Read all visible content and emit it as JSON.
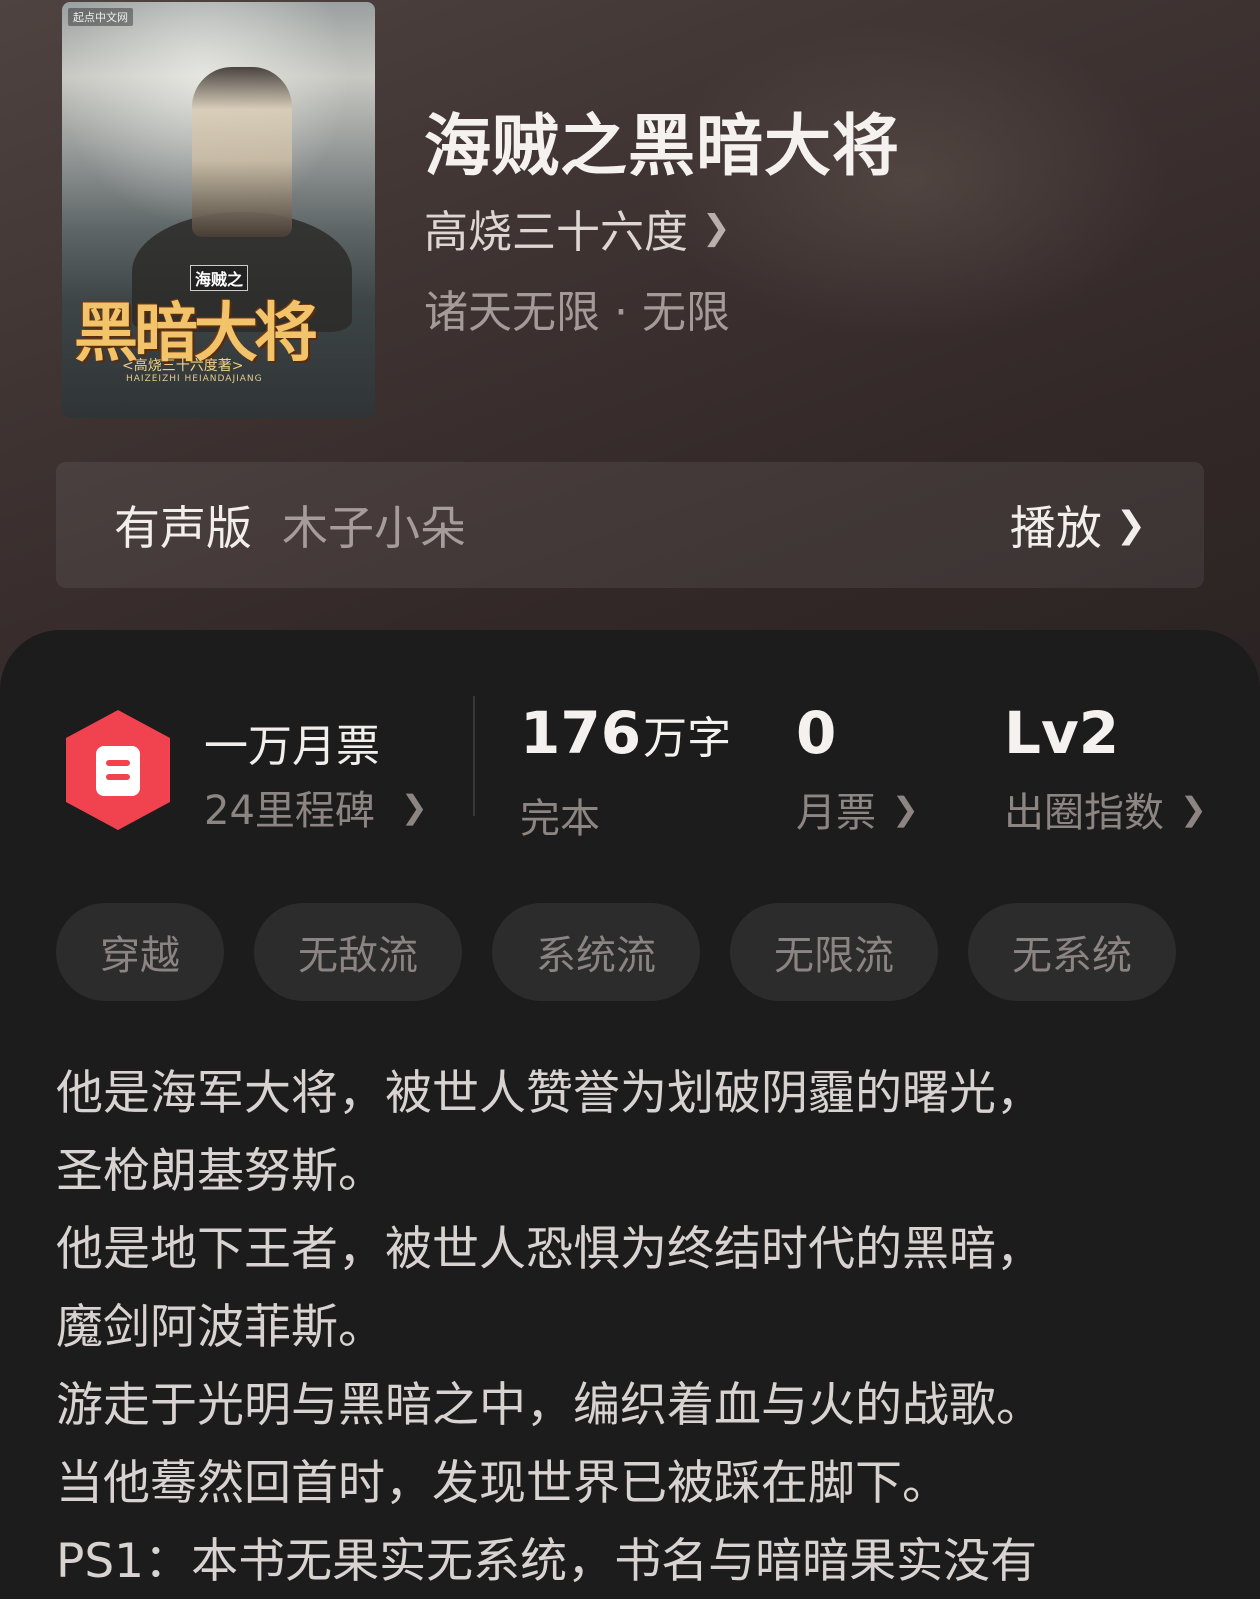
{
  "book": {
    "title": "海贼之黑暗大将",
    "author": "高烧三十六度",
    "category": "诸天无限 · 无限",
    "cover": {
      "publisher_badge": "起点中文网",
      "small_title": "海贼之",
      "big_title": "黑暗大将",
      "author_line": "<高烧三十六度著>",
      "pinyin": "HAIZEIZHI HEIANDAJIANG"
    }
  },
  "audio": {
    "label": "有声版",
    "narrator": "木子小朵",
    "play_label": "播放"
  },
  "monthly_ticket": {
    "title": "一万月票",
    "milestones": "24里程碑"
  },
  "stats": {
    "words_value": "176",
    "words_unit": "万字",
    "words_label": "完本",
    "tickets_value": "0",
    "tickets_label": "月票",
    "index_value": "Lv2",
    "index_label": "出圈指数"
  },
  "tags": [
    "穿越",
    "无敌流",
    "系统流",
    "无限流",
    "无系统"
  ],
  "description": [
    "他是海军大将，被世人赞誉为划破阴霾的曙光，",
    "圣枪朗基努斯。",
    "他是地下王者，被世人恐惧为终结时代的黑暗，",
    "魔剑阿波菲斯。",
    "游走于光明与黑暗之中，编织着血与火的战歌。",
    "当他蓦然回首时，发现世界已被踩在脚下。",
    "PS1：本书无果实无系统，书名与暗暗果实没有"
  ],
  "colors": {
    "ticket_icon": "#f0424f",
    "panel_bg": "#1d1c1c",
    "tag_bg": "#2d2c2c"
  },
  "icons": {
    "ticket": "ticket-hexagon-icon",
    "chevron": "chevron-right-icon"
  }
}
